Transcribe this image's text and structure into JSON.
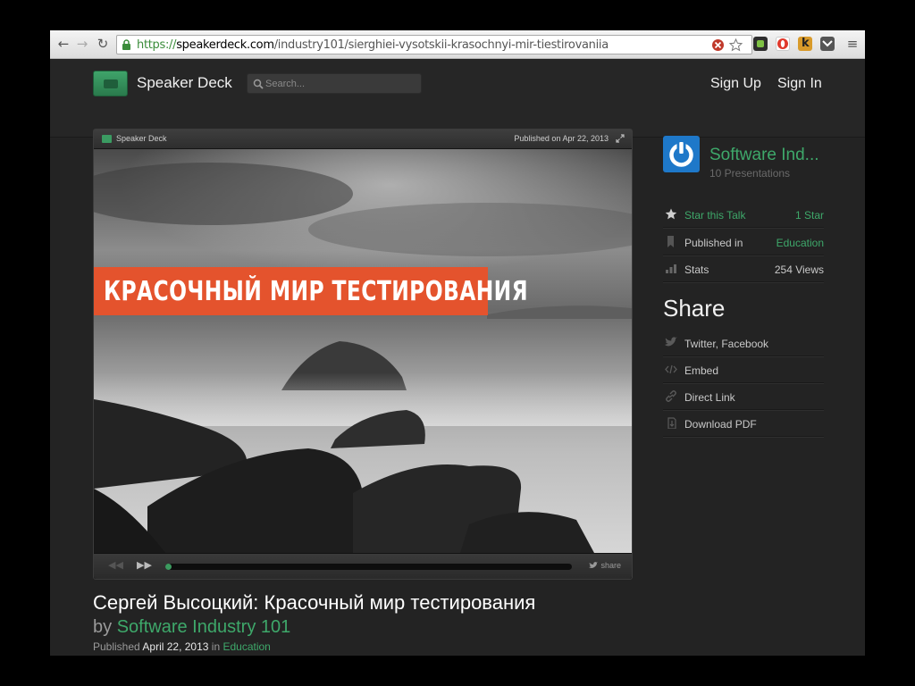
{
  "browser": {
    "url_scheme": "https://",
    "url_domain": "speakerdeck.com",
    "url_path": "/industry101/sierghiei-vysotskii-krasochnyi-mir-tiestirovaniia",
    "extension_icons": [
      "cloud-icon",
      "opera-icon",
      "kippt-icon",
      "pocket-icon"
    ]
  },
  "header": {
    "brand": "Speaker Deck",
    "search_placeholder": "Search...",
    "sign_up": "Sign Up",
    "sign_in": "Sign In"
  },
  "player": {
    "brand": "Speaker Deck",
    "published": "Published on Apr 22, 2013",
    "slide_title": "КРАСОЧНЫЙ МИР ТЕСТИРОВАНИЯ",
    "share": "share",
    "progress_fraction": 0.015
  },
  "talk": {
    "title": "Сергей Высоцкий: Красочный мир тестирования",
    "by_prefix": "by",
    "author": "Software Industry 101",
    "published_prefix": "Published",
    "published_date": "April 22, 2013",
    "in_word": "in",
    "category": "Education"
  },
  "sidebar": {
    "owner_name": "Software Ind...",
    "owner_count": "10 Presentations",
    "star_label": "Star this Talk",
    "star_value": "1 Star",
    "published_label": "Published in",
    "published_value": "Education",
    "stats_label": "Stats",
    "stats_value": "254 Views",
    "share_heading": "Share",
    "share_items": [
      "Twitter, Facebook",
      "Embed",
      "Direct Link",
      "Download PDF"
    ]
  },
  "colors": {
    "accent_green": "#3ea86a",
    "banner_orange": "#e4532d",
    "avatar_blue": "#1e78c9"
  }
}
